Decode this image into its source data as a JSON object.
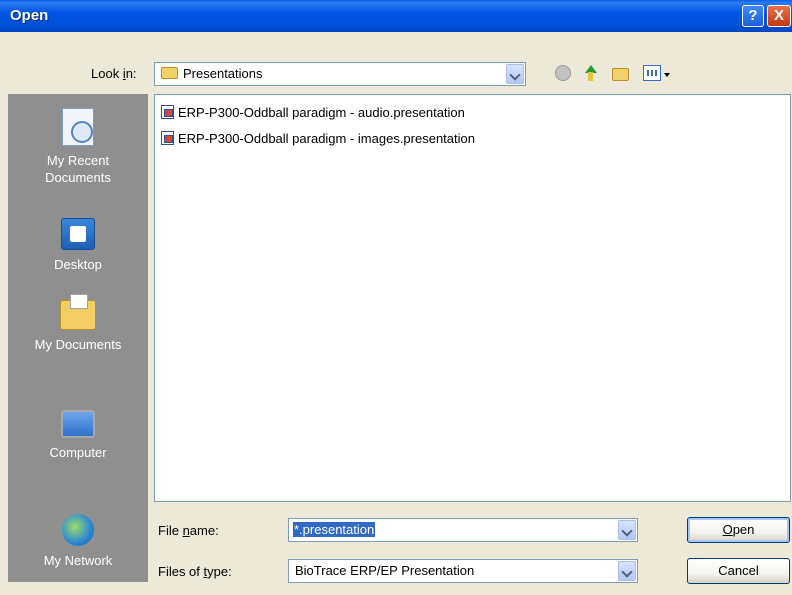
{
  "window": {
    "title": "Open",
    "help_label": "?",
    "close_label": "X"
  },
  "lookin": {
    "label_prefix": "Look ",
    "label_ul": "i",
    "label_suffix": "n:",
    "value": "Presentations"
  },
  "places": [
    {
      "line1": "My Recent",
      "line2": "Documents",
      "icon": "recent-documents-icon"
    },
    {
      "line1": "Desktop",
      "line2": "",
      "icon": "desktop-icon"
    },
    {
      "line1": "My Documents",
      "line2": "",
      "icon": "my-documents-icon"
    },
    {
      "line1": "Computer",
      "line2": "",
      "icon": "computer-icon"
    },
    {
      "line1": "My Network",
      "line2": "",
      "icon": "network-icon"
    }
  ],
  "files": [
    {
      "name": "ERP-P300-Oddball paradigm - audio.presentation"
    },
    {
      "name": "ERP-P300-Oddball paradigm - images.presentation"
    }
  ],
  "filename": {
    "label_prefix": "File ",
    "label_ul": "n",
    "label_suffix": "ame:",
    "value": "*.presentation"
  },
  "filetype": {
    "label_prefix": "Files of ",
    "label_ul": "t",
    "label_suffix": "ype:",
    "value": "BioTrace ERP/EP Presentation"
  },
  "buttons": {
    "open_ul": "O",
    "open_rest": "pen",
    "cancel": "Cancel"
  }
}
